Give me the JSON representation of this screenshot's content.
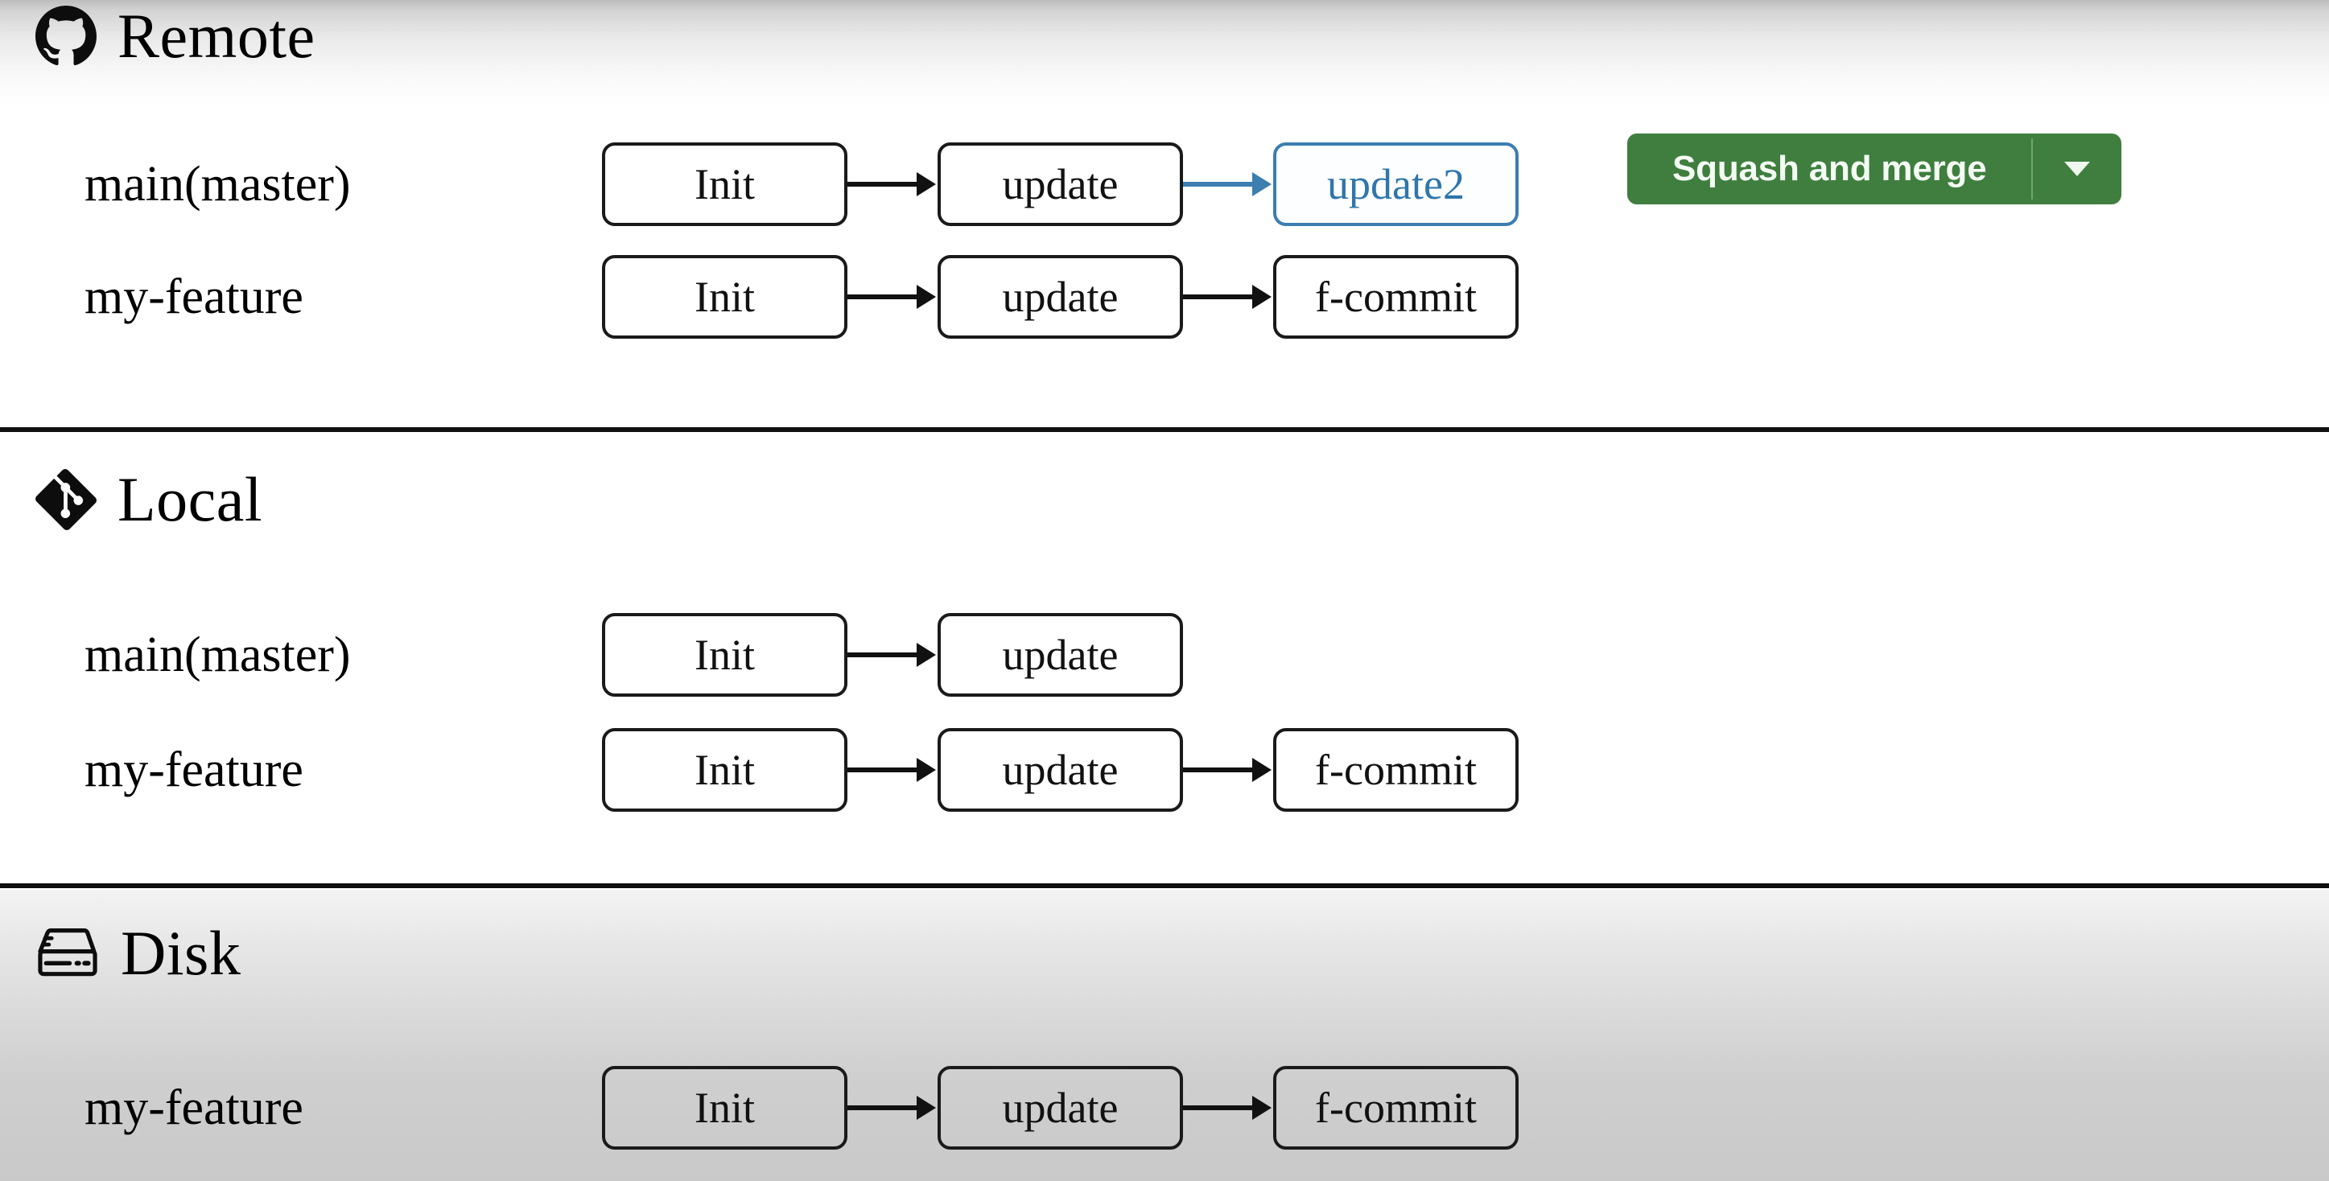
{
  "colors": {
    "accent_green": "#3f7e3f",
    "accent_blue": "#3c7eb0",
    "node_border": "#1a1a1a",
    "divider": "#111111",
    "disk_background": "#c9c9c9"
  },
  "sections": [
    {
      "id": "remote",
      "title": "Remote",
      "icon": "github-icon",
      "rows": [
        {
          "label": "main(master)",
          "commits": [
            {
              "label": "Init",
              "style": "default"
            },
            {
              "label": "update",
              "style": "default"
            },
            {
              "label": "update2",
              "style": "highlight-blue"
            }
          ]
        },
        {
          "label": "my-feature",
          "commits": [
            {
              "label": "Init",
              "style": "default"
            },
            {
              "label": "update",
              "style": "default"
            },
            {
              "label": "f-commit",
              "style": "default"
            }
          ]
        }
      ],
      "action": {
        "label": "Squash and merge",
        "caret": "chevron-down-icon"
      }
    },
    {
      "id": "local",
      "title": "Local",
      "icon": "git-icon",
      "rows": [
        {
          "label": "main(master)",
          "commits": [
            {
              "label": "Init",
              "style": "default"
            },
            {
              "label": "update",
              "style": "default"
            }
          ]
        },
        {
          "label": "my-feature",
          "commits": [
            {
              "label": "Init",
              "style": "default"
            },
            {
              "label": "update",
              "style": "default"
            },
            {
              "label": "f-commit",
              "style": "default"
            }
          ]
        }
      ]
    },
    {
      "id": "disk",
      "title": "Disk",
      "icon": "hard-drive-icon",
      "rows": [
        {
          "label": "my-feature",
          "commits": [
            {
              "label": "Init",
              "style": "transparent"
            },
            {
              "label": "update",
              "style": "transparent"
            },
            {
              "label": "f-commit",
              "style": "transparent"
            }
          ]
        }
      ]
    }
  ]
}
